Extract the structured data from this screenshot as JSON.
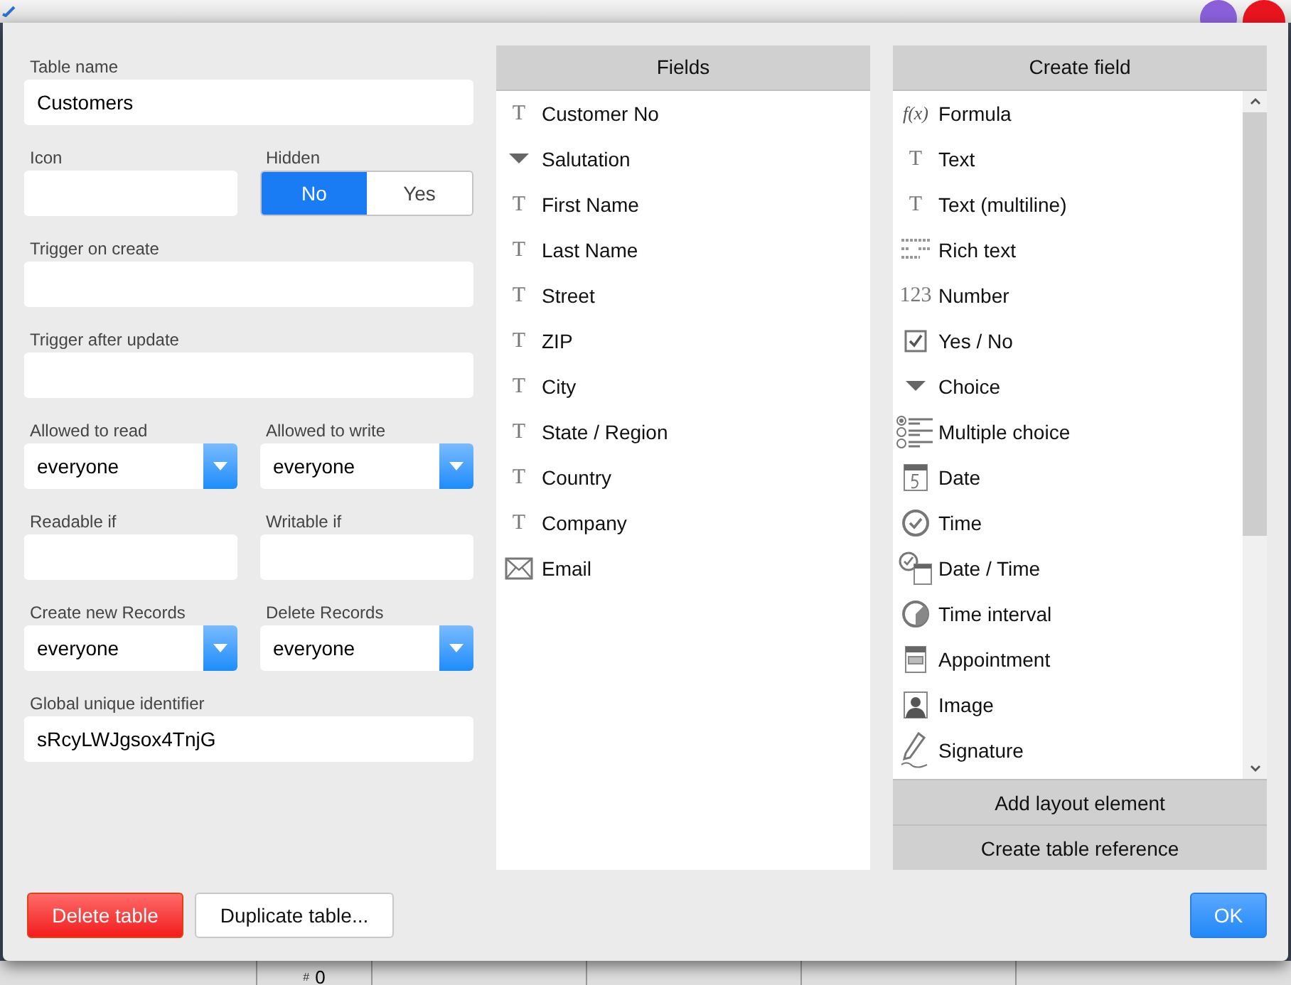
{
  "background_row": {
    "marker": "#",
    "value": "0"
  },
  "form": [
    {
      "kind": "text",
      "label": "Table name",
      "value": "Customers"
    },
    {
      "kind": "pair",
      "items": [
        {
          "kind": "text",
          "label": "Icon"
        },
        {
          "kind": "toggle",
          "label": "Hidden",
          "options": [
            {
              "label": "No",
              "selected": true
            },
            {
              "label": "Yes",
              "selected": false
            }
          ]
        }
      ]
    },
    {
      "kind": "text",
      "label": "Trigger on create"
    },
    {
      "kind": "text",
      "label": "Trigger after update"
    },
    {
      "kind": "pair",
      "items": [
        {
          "kind": "select",
          "label": "Allowed to read",
          "value": "everyone"
        },
        {
          "kind": "select",
          "label": "Allowed to write",
          "value": "everyone"
        }
      ]
    },
    {
      "kind": "pair",
      "items": [
        {
          "kind": "text",
          "label": "Readable if"
        },
        {
          "kind": "text",
          "label": "Writable if"
        }
      ]
    },
    {
      "kind": "pair",
      "items": [
        {
          "kind": "select",
          "label": "Create new Records",
          "value": "everyone"
        },
        {
          "kind": "select",
          "label": "Delete Records",
          "value": "everyone"
        }
      ]
    },
    {
      "kind": "text",
      "label": "Global unique identifier",
      "value": "sRcyLWJgsox4TnjG"
    }
  ],
  "fields": {
    "title": "Fields",
    "items": [
      {
        "label": "Customer No",
        "kind": "text",
        "glyph": "T"
      },
      {
        "label": "Salutation",
        "kind": "choice"
      },
      {
        "label": "First Name",
        "kind": "text",
        "glyph": "T"
      },
      {
        "label": "Last Name",
        "kind": "text",
        "glyph": "T"
      },
      {
        "label": "Street",
        "kind": "text",
        "glyph": "T"
      },
      {
        "label": "ZIP",
        "kind": "text",
        "glyph": "T"
      },
      {
        "label": "City",
        "kind": "text",
        "glyph": "T"
      },
      {
        "label": "State / Region",
        "kind": "text",
        "glyph": "T"
      },
      {
        "label": "Country",
        "kind": "text",
        "glyph": "T"
      },
      {
        "label": "Company",
        "kind": "text",
        "glyph": "T"
      },
      {
        "label": "Email",
        "kind": "email"
      }
    ]
  },
  "create_field": {
    "title": "Create field",
    "items": [
      {
        "label": "Formula",
        "kind": "formula",
        "glyph": "f(x)"
      },
      {
        "label": "Text",
        "kind": "text",
        "glyph": "T"
      },
      {
        "label": "Text (multiline)",
        "kind": "text",
        "glyph": "T"
      },
      {
        "label": "Rich text",
        "kind": "rich_text"
      },
      {
        "label": "Number",
        "kind": "number",
        "glyph": "123"
      },
      {
        "label": "Yes / No",
        "kind": "yes_no"
      },
      {
        "label": "Choice",
        "kind": "choice"
      },
      {
        "label": "Multiple choice",
        "kind": "multiple_choice"
      },
      {
        "label": "Date",
        "kind": "date"
      },
      {
        "label": "Time",
        "kind": "time"
      },
      {
        "label": "Date / Time",
        "kind": "date_time"
      },
      {
        "label": "Time interval",
        "kind": "time_interval"
      },
      {
        "label": "Appointment",
        "kind": "appointment"
      },
      {
        "label": "Image",
        "kind": "image"
      },
      {
        "label": "Signature",
        "kind": "signature"
      }
    ],
    "actions": [
      "Add layout element",
      "Create table reference"
    ]
  },
  "footer_buttons": [
    {
      "label": "Delete table",
      "kind": "danger"
    },
    {
      "label": "Duplicate table...",
      "kind": "default"
    },
    {
      "label": "OK",
      "kind": "primary"
    }
  ]
}
